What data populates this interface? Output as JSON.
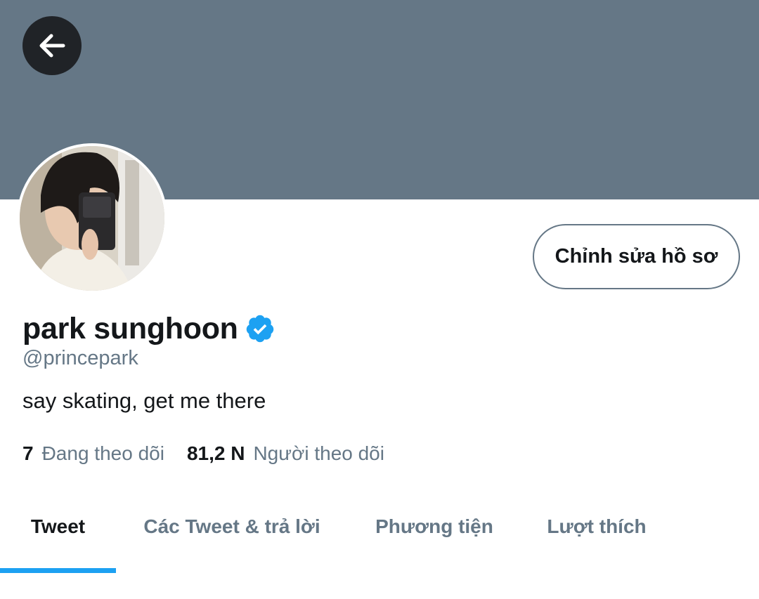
{
  "header": {
    "back_icon": "arrow-left-icon"
  },
  "profile": {
    "avatar": "profile-photo",
    "edit_button_label": "Chỉnh sửa hồ sơ",
    "name": "park sunghoon",
    "verified_icon": "verified-badge-icon",
    "handle": "@princepark",
    "bio": "say skating, get me there",
    "following_count": "7",
    "following_label": "Đang theo dõi",
    "followers_count": "81,2 N",
    "followers_label": "Người theo dõi"
  },
  "tabs": [
    {
      "label": "Tweet",
      "active": true
    },
    {
      "label": "Các Tweet & trả lời",
      "active": false
    },
    {
      "label": "Phương tiện",
      "active": false
    },
    {
      "label": "Lượt thích",
      "active": false
    }
  ],
  "colors": {
    "banner": "#657786",
    "accent": "#1da1f2",
    "secondary_text": "#657786",
    "primary_text": "#14171a"
  }
}
